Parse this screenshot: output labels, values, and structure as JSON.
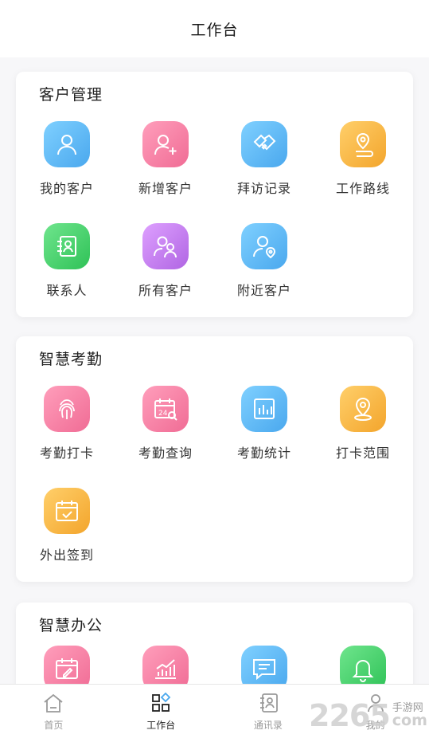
{
  "header": {
    "title": "工作台"
  },
  "sections": [
    {
      "title": "客户管理",
      "items": [
        {
          "label": "我的客户",
          "icon": "person-icon",
          "color": "#5ab8f0"
        },
        {
          "label": "新增客户",
          "icon": "add-person-icon",
          "color": "#f57aa0"
        },
        {
          "label": "拜访记录",
          "icon": "handshake-icon",
          "color": "#5ab8f0"
        },
        {
          "label": "工作路线",
          "icon": "route-icon",
          "color": "#f6b23a"
        },
        {
          "label": "联系人",
          "icon": "contact-card-icon",
          "color": "#3fd46a"
        },
        {
          "label": "所有客户",
          "icon": "group-icon",
          "color": "#c07ae8"
        },
        {
          "label": "附近客户",
          "icon": "person-location-icon",
          "color": "#5ab8f0"
        }
      ]
    },
    {
      "title": "智慧考勤",
      "items": [
        {
          "label": "考勤打卡",
          "icon": "fingerprint-icon",
          "color": "#f57aa0"
        },
        {
          "label": "考勤查询",
          "icon": "calendar-search-icon",
          "color": "#f57aa0"
        },
        {
          "label": "考勤统计",
          "icon": "bar-chart-icon",
          "color": "#5ab8f0"
        },
        {
          "label": "打卡范围",
          "icon": "location-pin-icon",
          "color": "#f6b23a"
        },
        {
          "label": "外出签到",
          "icon": "calendar-check-icon",
          "color": "#f6b23a"
        }
      ]
    },
    {
      "title": "智慧办公",
      "items": [
        {
          "label": "",
          "icon": "calendar-edit-icon",
          "color": "#f57aa0"
        },
        {
          "label": "",
          "icon": "trend-chart-icon",
          "color": "#f57aa0"
        },
        {
          "label": "",
          "icon": "message-icon",
          "color": "#5ab8f0"
        },
        {
          "label": "",
          "icon": "bell-icon",
          "color": "#3fd46a"
        }
      ]
    }
  ],
  "tabbar": [
    {
      "label": "首页",
      "icon": "home-icon",
      "active": false
    },
    {
      "label": "工作台",
      "icon": "grid-icon",
      "active": true
    },
    {
      "label": "通讯录",
      "icon": "address-book-icon",
      "active": false
    },
    {
      "label": "我的",
      "icon": "profile-icon",
      "active": false
    }
  ],
  "watermark": {
    "number": "2265",
    "top": "手游网",
    "bottom": "com"
  }
}
